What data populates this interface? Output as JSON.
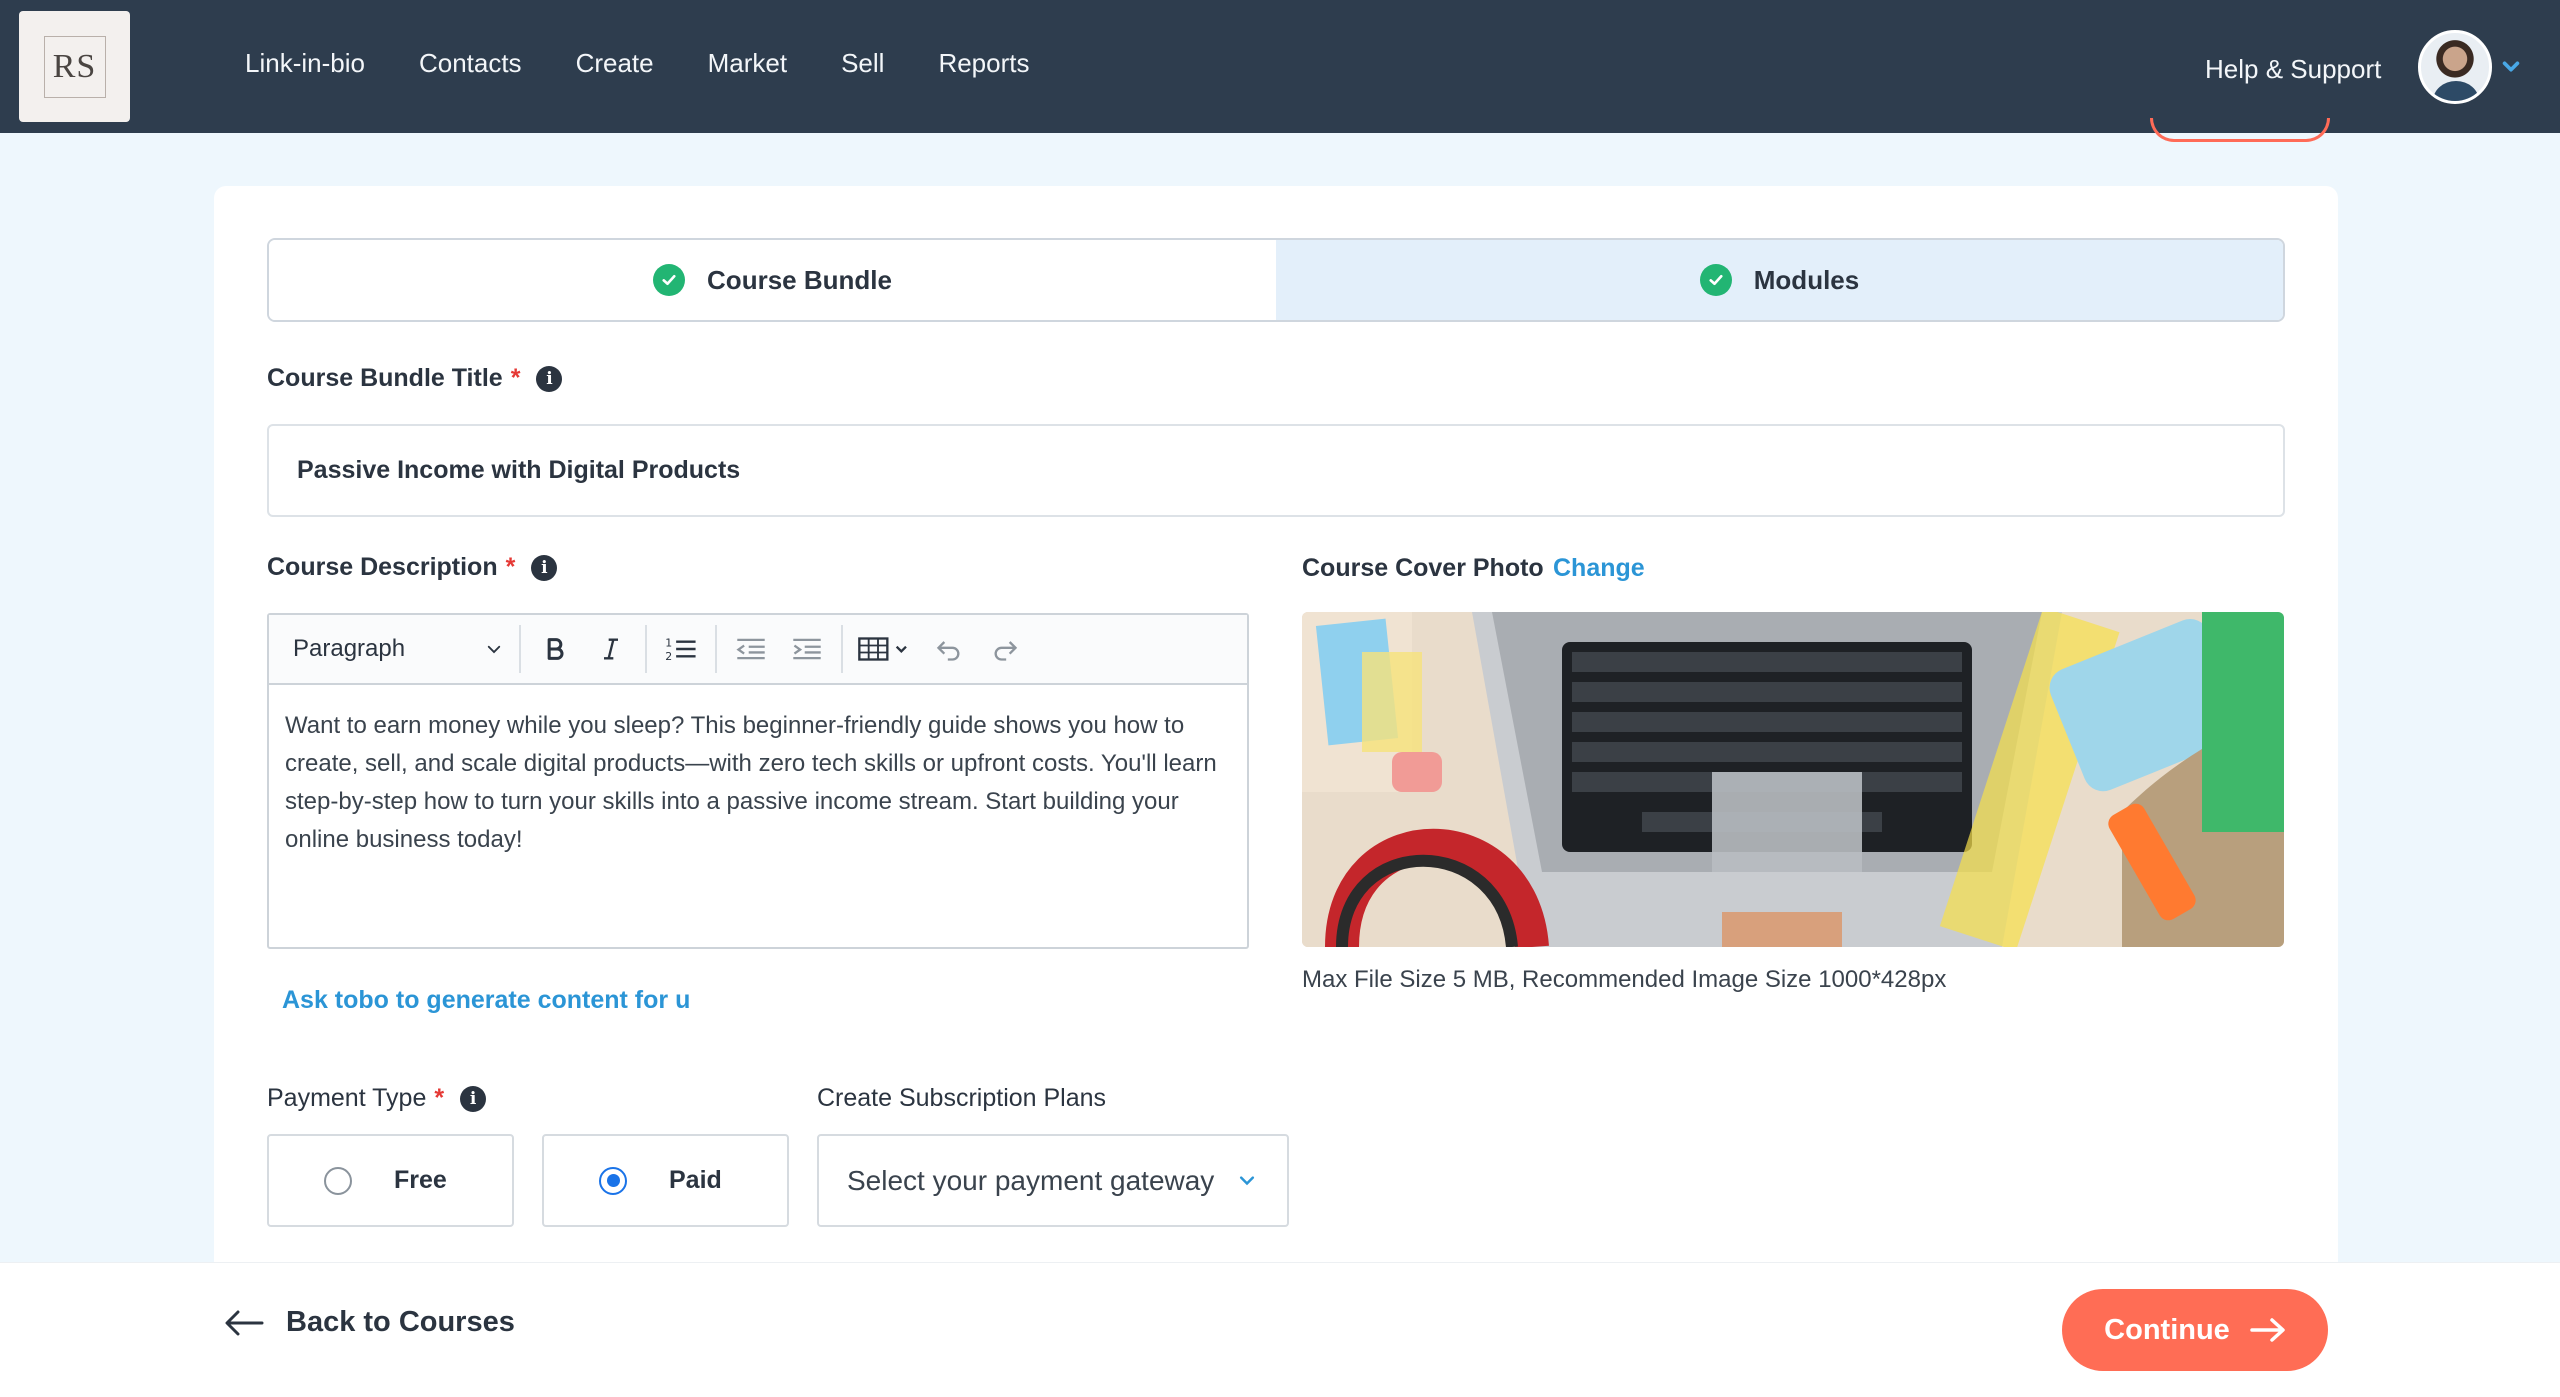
{
  "brand": {
    "logo_text": "RS"
  },
  "nav": {
    "items": [
      "Link-in-bio",
      "Contacts",
      "Create",
      "Market",
      "Sell",
      "Reports"
    ],
    "help": "Help & Support"
  },
  "steps": [
    {
      "label": "Course Bundle",
      "status": "complete"
    },
    {
      "label": "Modules",
      "status": "complete"
    }
  ],
  "form": {
    "title_label": "Course Bundle Title",
    "title_value": "Passive Income with Digital Products",
    "description_label": "Course Description",
    "editor": {
      "block_format": "Paragraph",
      "text": "Want to earn money while you sleep? This beginner-friendly guide shows you how to create, sell, and scale digital products—with zero tech skills or upfront costs. You'll learn step-by-step how to turn your skills into a passive income stream. Start building your online business today!"
    },
    "ai_link": "Ask tobo to generate content for u",
    "cover_label": "Course Cover Photo",
    "cover_change": "Change",
    "cover_hint": "Max File Size 5 MB, Recommended Image Size 1000*428px",
    "payment_label": "Payment Type",
    "payment_options": [
      {
        "label": "Free",
        "selected": false
      },
      {
        "label": "Paid",
        "selected": true
      }
    ],
    "subscription_label": "Create Subscription Plans",
    "gateway_placeholder": "Select your payment gateway",
    "required_mark": "*"
  },
  "footer": {
    "back_label": "Back to Courses",
    "continue_label": "Continue"
  },
  "colors": {
    "nav_bg": "#2e3d4e",
    "accent": "#ff6d55",
    "link": "#2b95d6",
    "check": "#22b573",
    "radio": "#1a73e8"
  }
}
